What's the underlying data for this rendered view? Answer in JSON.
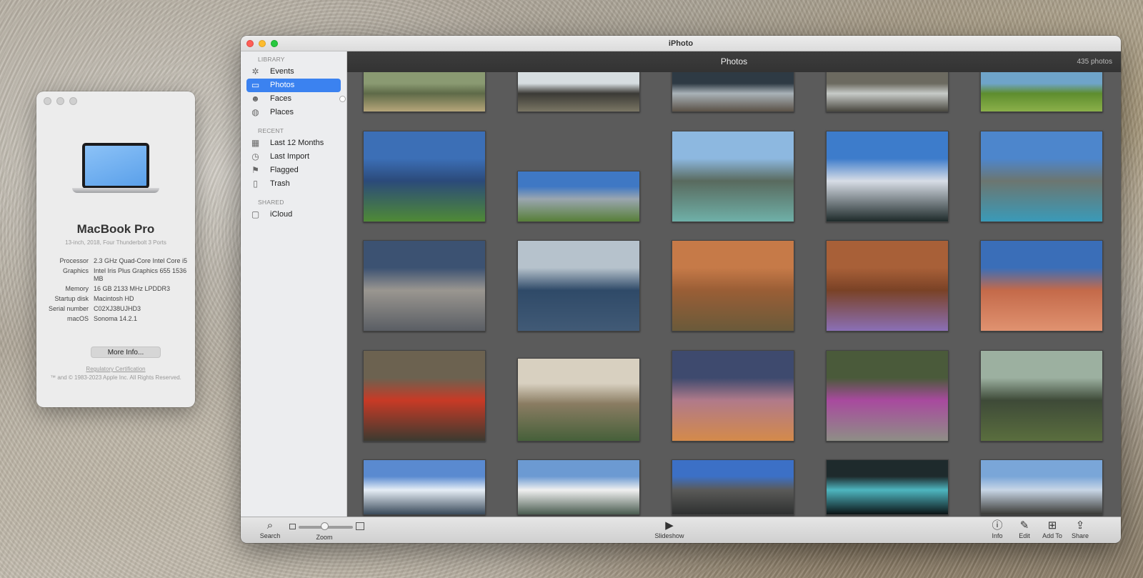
{
  "about": {
    "model": "MacBook Pro",
    "subtitle": "13-inch, 2018, Four Thunderbolt 3 Ports",
    "specs": [
      {
        "key": "Processor",
        "value": "2.3 GHz Quad-Core Intel Core i5"
      },
      {
        "key": "Graphics",
        "value": "Intel Iris Plus Graphics 655 1536 MB"
      },
      {
        "key": "Memory",
        "value": "16 GB 2133 MHz LPDDR3"
      },
      {
        "key": "Startup disk",
        "value": "Macintosh HD"
      },
      {
        "key": "Serial number",
        "value": "C02XJ38UJHD3"
      },
      {
        "key": "macOS",
        "value": "Sonoma 14.2.1"
      }
    ],
    "more_info": "More Info...",
    "regulatory": "Regulatory Certification",
    "copyright": "™ and © 1983-2023 Apple Inc. All Rights Reserved."
  },
  "window": {
    "title": "iPhoto"
  },
  "sidebar": {
    "library_heading": "LIBRARY",
    "library_items": [
      {
        "label": "Events",
        "icon": "palm-tree-icon",
        "glyph": "✲",
        "active": false
      },
      {
        "label": "Photos",
        "icon": "photos-icon",
        "glyph": "▭",
        "active": true
      },
      {
        "label": "Faces",
        "icon": "faces-icon",
        "glyph": "☻",
        "active": false
      },
      {
        "label": "Places",
        "icon": "globe-icon",
        "glyph": "◍",
        "active": false
      }
    ],
    "recent_heading": "RECENT",
    "recent_items": [
      {
        "label": "Last 12 Months",
        "icon": "calendar-icon",
        "glyph": "▦"
      },
      {
        "label": "Last Import",
        "icon": "clock-icon",
        "glyph": "◷"
      },
      {
        "label": "Flagged",
        "icon": "flag-icon",
        "glyph": "⚑"
      },
      {
        "label": "Trash",
        "icon": "trash-icon",
        "glyph": "▯"
      }
    ],
    "shared_heading": "SHARED",
    "shared_items": [
      {
        "label": "iCloud",
        "icon": "icloud-icon",
        "glyph": "▢"
      }
    ]
  },
  "main": {
    "title": "Photos",
    "count": "435 photos"
  },
  "photos": [
    {
      "name": "photo-river-wader",
      "colors": [
        "#8a9a72",
        "#5e6a48",
        "#b6a67a"
      ]
    },
    {
      "name": "photo-waterfall-swimmer",
      "colors": [
        "#d6dde0",
        "#3b3a36",
        "#7a7664"
      ]
    },
    {
      "name": "photo-rocky-creek",
      "colors": [
        "#2e3a44",
        "#a9b2b8",
        "#5b5248"
      ]
    },
    {
      "name": "photo-rapids",
      "colors": [
        "#6c6a60",
        "#c7cbc8",
        "#4a4840"
      ]
    },
    {
      "name": "photo-bighorn-meadow",
      "colors": [
        "#6fa4c9",
        "#5e8d2e",
        "#8bb04a"
      ]
    },
    {
      "name": "photo-mountain-lake",
      "colors": [
        "#3c6fb6",
        "#2b4a7a",
        "#4f8a36"
      ]
    },
    {
      "name": "photo-bearhat-mountain",
      "colors": [
        "#3f78c4",
        "#9aa6b0",
        "#577f38"
      ]
    },
    {
      "name": "photo-lake-louise",
      "colors": [
        "#8db8e0",
        "#596a5e",
        "#6fb0a8"
      ]
    },
    {
      "name": "photo-cumulus-cloud",
      "colors": [
        "#3d7ccb",
        "#d7dde6",
        "#1e2a2a"
      ]
    },
    {
      "name": "photo-bow-lake",
      "colors": [
        "#4d86cc",
        "#6c7670",
        "#3a9ab8"
      ]
    },
    {
      "name": "photo-inukshuk",
      "colors": [
        "#3c5272",
        "#9a9690",
        "#5a5e64"
      ]
    },
    {
      "name": "photo-sailboat",
      "colors": [
        "#b6c2cc",
        "#2f4a68",
        "#415a76"
      ]
    },
    {
      "name": "photo-horned-lizard",
      "colors": [
        "#c67a48",
        "#9a5e36",
        "#6a5a3a"
      ]
    },
    {
      "name": "photo-purple-flower",
      "colors": [
        "#a86038",
        "#7a4226",
        "#8a6fb6"
      ]
    },
    {
      "name": "photo-red-rock",
      "colors": [
        "#3a6eb8",
        "#c46a4a",
        "#e09270"
      ]
    },
    {
      "name": "photo-paintbrush",
      "colors": [
        "#6c6250",
        "#c83a26",
        "#3c3a30"
      ]
    },
    {
      "name": "photo-sunbeams-forest",
      "colors": [
        "#d8d0c0",
        "#8a7c62",
        "#46603a"
      ]
    },
    {
      "name": "photo-sunset-sky",
      "colors": [
        "#3e4a6e",
        "#b07a8a",
        "#d48a4a"
      ]
    },
    {
      "name": "photo-fireweed-rock",
      "colors": [
        "#4a5a3a",
        "#a84a9e",
        "#8e8e86"
      ]
    },
    {
      "name": "photo-old-forest",
      "colors": [
        "#9cb0a0",
        "#3e4a38",
        "#5a6e3e"
      ]
    },
    {
      "name": "photo-reflection-lake",
      "colors": [
        "#5a8ad0",
        "#e6eef6",
        "#3a4a5a"
      ]
    },
    {
      "name": "photo-glacier-valley",
      "colors": [
        "#6c9ad2",
        "#f0f0f0",
        "#4a5c50"
      ]
    },
    {
      "name": "photo-sea-rocks",
      "colors": [
        "#3c70c6",
        "#5a5a58",
        "#2e3030"
      ]
    },
    {
      "name": "photo-cave-water",
      "colors": [
        "#1e2a2c",
        "#4eb6c0",
        "#0c1416"
      ]
    },
    {
      "name": "photo-coast-rock",
      "colors": [
        "#7aa6d8",
        "#c8d6e6",
        "#3a3a36"
      ]
    }
  ],
  "toolbar": {
    "search": "Search",
    "zoom": "Zoom",
    "slideshow": "Slideshow",
    "info": "Info",
    "edit": "Edit",
    "add_to": "Add To",
    "share": "Share"
  }
}
